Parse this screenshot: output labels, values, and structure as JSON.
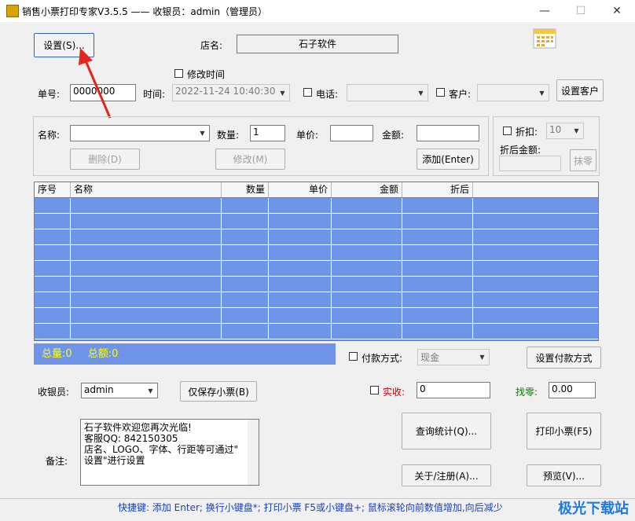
{
  "window": {
    "title": "销售小票打印专家V3.5.5 —— 收银员：admin（管理员）",
    "minimize_glyph": "—",
    "maximize_glyph": "☐",
    "close_glyph": "✕"
  },
  "top": {
    "settings_button": "设置(S)...",
    "store_label": "店名:",
    "store_name": "石子软件",
    "modify_time_label": "修改时间",
    "order_label": "单号:",
    "order_value": "0000000",
    "time_label": "时间:",
    "time_value": "2022-11-24 10:40:30",
    "phone_label": "电话:",
    "customer_label": "客户:",
    "set_customer_button": "设置客户"
  },
  "item": {
    "name_label": "名称:",
    "name_value": "",
    "qty_label": "数量:",
    "qty_value": "1",
    "price_label": "单价:",
    "price_value": "",
    "amount_label": "金额:",
    "amount_value": "",
    "delete_button": "删除(D)",
    "modify_button": "修改(M)",
    "add_button": "添加(Enter)",
    "discount_label": "折扣:",
    "discount_value": "10",
    "after_discount_label": "折后金额:",
    "after_discount_value": "",
    "round_button": "抹零"
  },
  "grid": {
    "columns": [
      "序号",
      "名称",
      "数量",
      "单价",
      "金额",
      "折后"
    ],
    "row_count": 9
  },
  "totals": {
    "total_qty": "总量:0",
    "total_amount": "总额:0"
  },
  "payment": {
    "method_label": "付款方式:",
    "method_value": "现金",
    "set_method_button": "设置付款方式"
  },
  "cashier": {
    "label": "收银员:",
    "value": "admin",
    "save_only_button": "仅保存小票(B)",
    "received_label": "实收:",
    "received_value": "0",
    "change_label": "找零:",
    "change_value": "0.00"
  },
  "notes": {
    "label": "备注:",
    "lines": [
      "石子软件欢迎您再次光临!",
      "客服QQ: 842150305",
      "店名、LOGO、字体、行距等可通过\"",
      "设置\"进行设置"
    ]
  },
  "actions": {
    "query_button": "查询统计(Q)...",
    "print_button": "打印小票(F5)",
    "about_button": "关于/注册(A)...",
    "preview_button": "预览(V)..."
  },
  "statusbar": {
    "text": "快捷键: 添加 Enter; 换行小键盘*; 打印小票 F5或小键盘+; 鼠标滚轮向前数值增加,向后减少"
  },
  "watermark": {
    "text": "极光下载站"
  },
  "colors": {
    "grid_blue": "#7095e8",
    "totals_yellow": "#ffff00",
    "received_red": "#d00000",
    "change_green": "#008000",
    "status_blue": "#1a3fb8",
    "arrow_red": "#e8231b"
  },
  "icons": {
    "calendar": "calendar-icon",
    "app": "app-icon"
  }
}
